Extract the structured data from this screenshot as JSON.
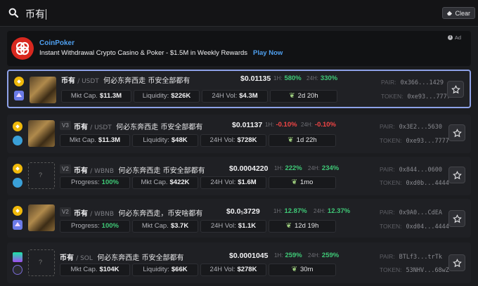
{
  "search": {
    "query": "币有",
    "clear_label": "Clear"
  },
  "ad": {
    "title": "CoinPoker",
    "text": "Instant Withdrawal Crypto Casino & Poker - $1.5M in Weekly Rewards",
    "cta": "Play Now",
    "label": "Ad"
  },
  "rows": [
    {
      "version": "",
      "symbol": "币有",
      "quote": "/ USDT",
      "name": "何必东奔西走 币安全部都有",
      "price": "$0.01135",
      "h1_label": "1H:",
      "h1": "580%",
      "h24_label": "24H:",
      "h24": "330%",
      "pill1_key": "Mkt Cap.",
      "pill1_val": "$11.3M",
      "pill2_key": "Liquidity:",
      "pill2_val": "$226K",
      "pill3_key": "24H Vol:",
      "pill3_val": "$4.3M",
      "age": "2d 20h",
      "pair_label": "PAIR:",
      "pair": "0x366...1429",
      "token_label": "TOKEN:",
      "token": "0xe93...7777"
    },
    {
      "version": "V3",
      "symbol": "币有",
      "quote": "/ USDT",
      "name": "何必东奔西走 币安全部都有",
      "price": "$0.01137",
      "h1_label": "1H:",
      "h1": "-0.10%",
      "h24_label": "24H:",
      "h24": "-0.10%",
      "pill1_key": "Mkt Cap.",
      "pill1_val": "$11.3M",
      "pill2_key": "Liquidity:",
      "pill2_val": "$48K",
      "pill3_key": "24H Vol:",
      "pill3_val": "$728K",
      "age": "1d 22h",
      "pair_label": "PAIR:",
      "pair": "0x3E2...5630",
      "token_label": "TOKEN:",
      "token": "0xe93...7777"
    },
    {
      "version": "V2",
      "symbol": "币有",
      "quote": "/ WBNB",
      "name": "何必东奔西走 币安全部都有",
      "price": "$0.0004220",
      "h1_label": "1H:",
      "h1": "222%",
      "h24_label": "24H:",
      "h24": "234%",
      "pill1_key": "Progress:",
      "pill1_val": "100%",
      "pill2_key": "Mkt Cap.",
      "pill2_val": "$422K",
      "pill3_key": "24H Vol:",
      "pill3_val": "$1.6M",
      "age": "1mo",
      "pair_label": "PAIR:",
      "pair": "0x844...0600",
      "token_label": "TOKEN:",
      "token": "0xd0b...4444"
    },
    {
      "version": "V2",
      "symbol": "币有",
      "quote": "/ WBNB",
      "name": "何必东奔西走，币安啥都有",
      "price_main": "$0.0",
      "price_sub": "5",
      "price_tail": "3729",
      "h1_label": "1H:",
      "h1": "12.87%",
      "h24_label": "24H:",
      "h24": "12.37%",
      "pill1_key": "Progress:",
      "pill1_val": "100%",
      "pill2_key": "Mkt Cap.",
      "pill2_val": "$3.7K",
      "pill3_key": "24H Vol:",
      "pill3_val": "$1.1K",
      "age": "12d 19h",
      "pair_label": "PAIR:",
      "pair": "0x9A0...CdEA",
      "token_label": "TOKEN:",
      "token": "0xd04...4444"
    },
    {
      "version": "",
      "symbol": "币有",
      "quote": "/ SOL",
      "name": "何必东奔西走 币安全部都有",
      "price": "$0.0001045",
      "h1_label": "1H:",
      "h1": "259%",
      "h24_label": "24H:",
      "h24": "259%",
      "pill1_key": "Mkt Cap.",
      "pill1_val": "$104K",
      "pill2_key": "Liquidity:",
      "pill2_val": "$66K",
      "pill3_key": "24H Vol:",
      "pill3_val": "$278K",
      "age": "30m",
      "pair_label": "PAIR:",
      "pair": "BTLf3...trTk",
      "token_label": "TOKEN:",
      "token": "53NHV...68wZ"
    }
  ],
  "empty_image_glyph": "?",
  "colors": {
    "positive": "#3fc977",
    "negative": "#f24545",
    "accent": "#4fa0f0",
    "selected_border": "#8ea2e8"
  }
}
